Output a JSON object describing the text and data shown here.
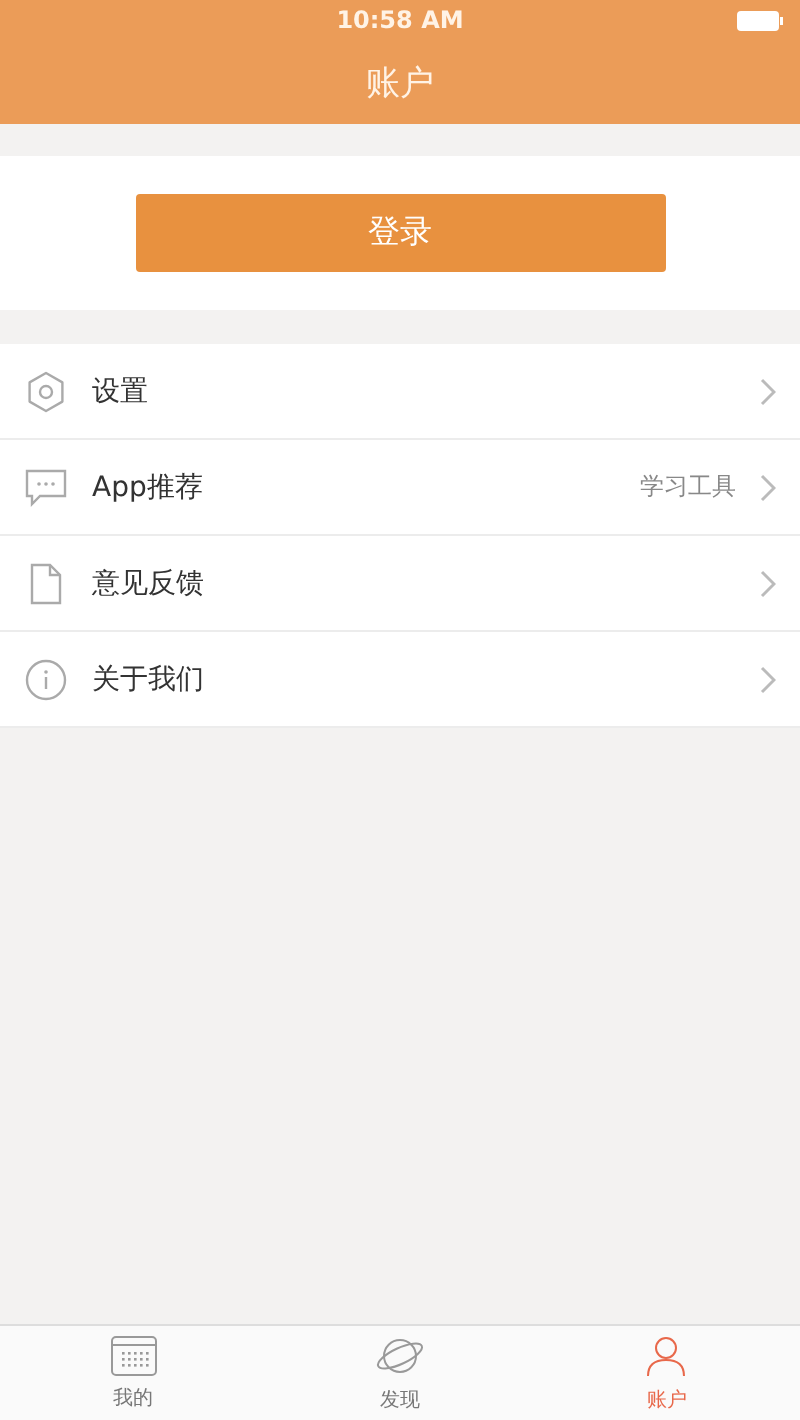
{
  "status_bar": {
    "time": "10:58 AM"
  },
  "nav": {
    "title": "账户"
  },
  "login_button": "登录",
  "menu": [
    {
      "kind": "settings",
      "label": "设置"
    },
    {
      "kind": "apps",
      "label": "App推荐",
      "detail": "学习工具"
    },
    {
      "kind": "feedback",
      "label": "意见反馈"
    },
    {
      "kind": "about",
      "label": "关于我们"
    }
  ],
  "tabs": [
    {
      "kind": "mine",
      "label": "我的",
      "selected": false
    },
    {
      "kind": "discover",
      "label": "发现",
      "selected": false
    },
    {
      "kind": "account",
      "label": "账户",
      "selected": true
    }
  ]
}
